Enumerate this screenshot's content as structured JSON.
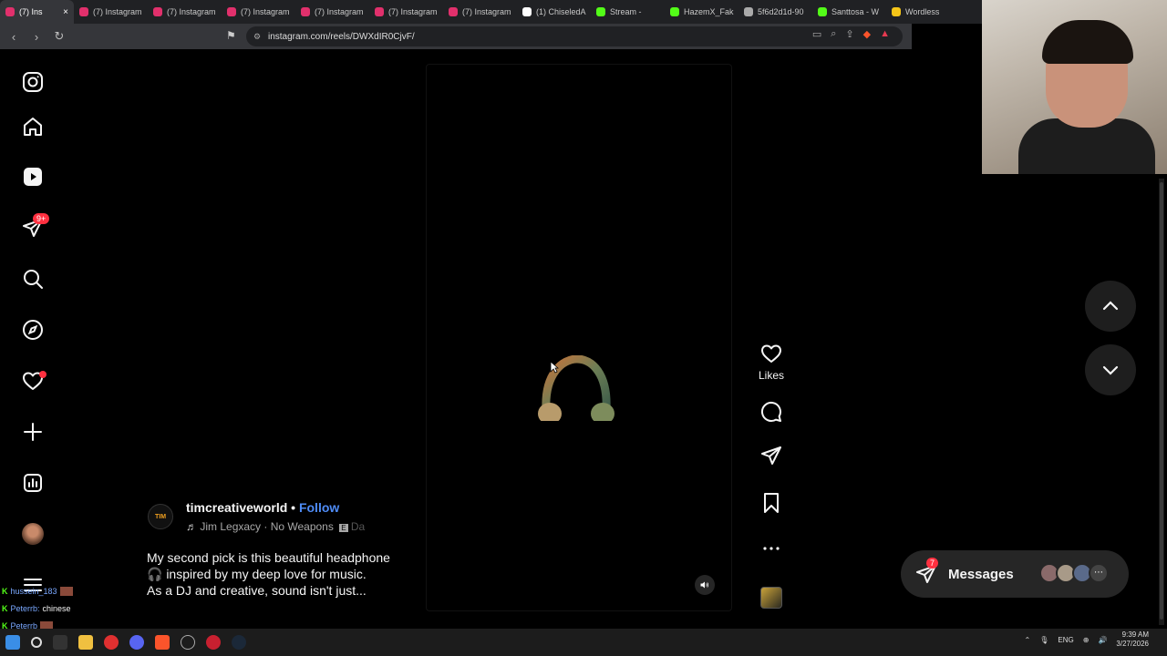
{
  "browser": {
    "tabs": [
      {
        "label": "(7) Ins",
        "icon": "instagram-icon",
        "active": true
      },
      {
        "label": "(7) Instagram",
        "icon": "instagram-icon"
      },
      {
        "label": "(7) Instagram",
        "icon": "instagram-icon"
      },
      {
        "label": "(7) Instagram",
        "icon": "instagram-icon"
      },
      {
        "label": "(7) Instagram",
        "icon": "instagram-icon"
      },
      {
        "label": "(7) Instagram",
        "icon": "instagram-icon"
      },
      {
        "label": "(7) Instagram",
        "icon": "instagram-icon"
      },
      {
        "label": "(1) ChiseledA",
        "icon": "x-icon"
      },
      {
        "label": "Stream -",
        "icon": "kick-icon"
      },
      {
        "label": "HazemX_Fak",
        "icon": "kick-icon"
      },
      {
        "label": "5f6d2d1d-90",
        "icon": "globe-icon"
      },
      {
        "label": "Santtosa - W",
        "icon": "kick-icon"
      },
      {
        "label": "Wordless",
        "icon": "wordless-icon"
      }
    ],
    "url": "instagram.com/reels/DWXdIR0CjvF/"
  },
  "sidebar": {
    "items": [
      {
        "name": "instagram-logo-icon"
      },
      {
        "name": "home-icon"
      },
      {
        "name": "reels-icon"
      },
      {
        "name": "direct-messages-icon"
      },
      {
        "name": "search-icon"
      },
      {
        "name": "explore-icon"
      },
      {
        "name": "notifications-icon"
      },
      {
        "name": "create-icon"
      },
      {
        "name": "dashboard-icon"
      },
      {
        "name": "profile-avatar"
      },
      {
        "name": "more-menu-icon"
      }
    ],
    "messages_badge": "9+"
  },
  "reel": {
    "author": "timcreativeworld",
    "separator": "•",
    "follow_label": "Follow",
    "avatar_text": "TIM",
    "music": "Jim Legxacy · No Weapons",
    "explicit": "E",
    "music_tail": "Da",
    "caption_lines": [
      "My second pick is this beautiful headphone",
      "🎧 inspired by my deep love for music.",
      "As a DJ and creative, sound isn't just..."
    ],
    "likes_label": "Likes"
  },
  "messages": {
    "label": "Messages",
    "badge": "7"
  },
  "chat": [
    {
      "user": "hussein_183",
      "text": ""
    },
    {
      "user": "Peterrb:",
      "text": "chinese"
    },
    {
      "user": "Peterrb",
      "text": ""
    }
  ],
  "tray": {
    "lang": "ENG",
    "time": "9:39 AM",
    "date": "3/27/2026"
  }
}
